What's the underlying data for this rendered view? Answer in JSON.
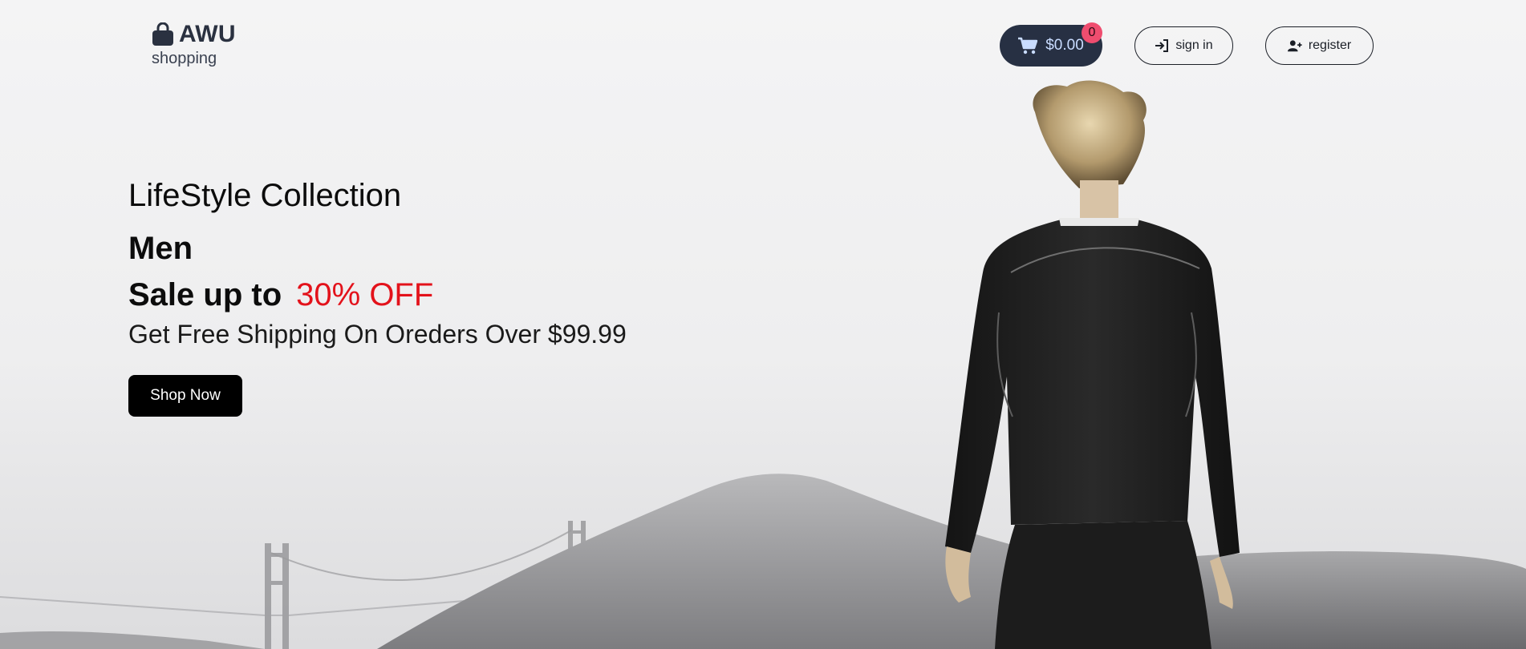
{
  "brand": {
    "name": "AWU",
    "tagline": "shopping",
    "icon": "shopping-bag-icon"
  },
  "header": {
    "cart": {
      "total": "$0.00",
      "count": "0",
      "icon": "cart-icon"
    },
    "signin": {
      "label": "sign in",
      "icon": "sign-in-icon"
    },
    "register": {
      "label": "register",
      "icon": "user-plus-icon"
    }
  },
  "hero": {
    "collection": "LifeStyle Collection",
    "category": "Men",
    "sale_prefix": "Sale up to",
    "sale_highlight": "30% OFF",
    "shipping": "Get Free Shipping On Oreders Over $99.99",
    "cta": "Shop Now"
  },
  "colors": {
    "header_dark": "#273043",
    "badge": "#ef4d6f",
    "sale_accent": "#e3121b",
    "cta_bg": "#000000"
  }
}
